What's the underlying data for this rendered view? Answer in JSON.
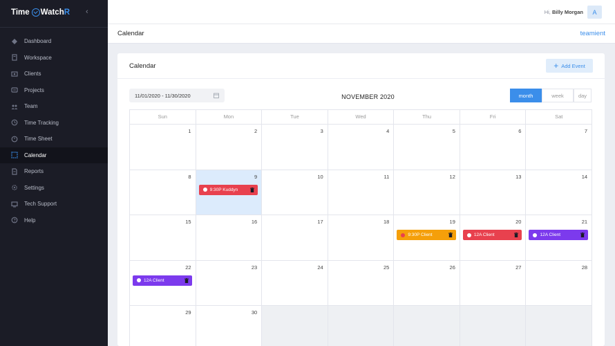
{
  "brand": {
    "part1": "Time",
    "part2": "Watch",
    "part3": "R"
  },
  "sidebar": {
    "items": [
      {
        "label": "Dashboard",
        "icon": "dashboard-icon",
        "active": false
      },
      {
        "label": "Workspace",
        "icon": "workspace-icon",
        "active": false
      },
      {
        "label": "Clients",
        "icon": "clients-icon",
        "active": false
      },
      {
        "label": "Projects",
        "icon": "projects-icon",
        "active": false
      },
      {
        "label": "Team",
        "icon": "team-icon",
        "active": false
      },
      {
        "label": "Time Tracking",
        "icon": "time-tracking-icon",
        "active": false
      },
      {
        "label": "Time Sheet",
        "icon": "time-sheet-icon",
        "active": false
      },
      {
        "label": "Calendar",
        "icon": "calendar-icon",
        "active": true
      },
      {
        "label": "Reports",
        "icon": "reports-icon",
        "active": false
      },
      {
        "label": "Settings",
        "icon": "settings-icon",
        "active": false
      },
      {
        "label": "Tech Support",
        "icon": "tech-support-icon",
        "active": false
      },
      {
        "label": "Help",
        "icon": "help-icon",
        "active": false
      }
    ]
  },
  "topbar": {
    "greeting": "Hi,",
    "user_name": "Billy Morgan",
    "avatar_letter": "A"
  },
  "page": {
    "title": "Calendar",
    "org_name": "teamient"
  },
  "card": {
    "title": "Calendar",
    "add_event_label": "Add Event",
    "date_range": "11/01/2020 - 11/30/2020",
    "month_title": "NOVEMBER 2020",
    "views": [
      "month",
      "week",
      "day"
    ],
    "active_view": "month"
  },
  "calendar": {
    "weekdays": [
      "Sun",
      "Mon",
      "Tue",
      "Wed",
      "Thu",
      "Fri",
      "Sat"
    ],
    "weeks": [
      [
        "1",
        "2",
        "3",
        "4",
        "5",
        "6",
        "7"
      ],
      [
        "8",
        "9",
        "10",
        "11",
        "12",
        "13",
        "14"
      ],
      [
        "15",
        "16",
        "17",
        "18",
        "19",
        "20",
        "21"
      ],
      [
        "22",
        "23",
        "24",
        "25",
        "26",
        "27",
        "28"
      ],
      [
        "29",
        "30",
        "",
        "",
        "",
        "",
        ""
      ]
    ],
    "today": "9",
    "events": [
      {
        "day": "9",
        "label": "9:30P Kuddyn",
        "color": "#e8414e",
        "dot": "#ffffff"
      },
      {
        "day": "19",
        "label": "9:30P Client",
        "color": "#f59f0a",
        "dot": "#e8414e"
      },
      {
        "day": "20",
        "label": "12A Client",
        "color": "#e8414e",
        "dot": "#ffffff"
      },
      {
        "day": "21",
        "label": "12A Client",
        "color": "#7c3aed",
        "dot": "#ffffff"
      },
      {
        "day": "22",
        "label": "12A Client",
        "color": "#7c3aed",
        "dot": "#ffffff"
      }
    ]
  },
  "colors": {
    "accent": "#3b8eea",
    "sidebar_bg": "#1b1c26",
    "today_bg": "#dcebfc"
  }
}
